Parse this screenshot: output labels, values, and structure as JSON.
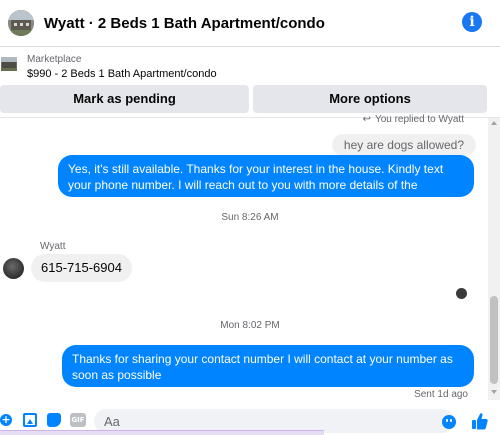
{
  "header": {
    "title": "Wyatt · 2 Beds 1 Bath Apartment/condo",
    "info_icon": "info-icon"
  },
  "listing": {
    "source": "Marketplace",
    "price_title": "$990 - 2 Beds 1 Bath Apartment/condo"
  },
  "actions": {
    "mark_pending": "Mark as pending",
    "more_options": "More options"
  },
  "messages": {
    "replied_label": "You replied to Wyatt",
    "quoted_text": "hey are dogs allowed?",
    "outgoing_1": "Yes, it's still available. Thanks for your interest in the house. Kindly text your phone number. I will reach out to you with more details of the property.",
    "timestamp_1": "Sun 8:26 AM",
    "sender_name": "Wyatt",
    "incoming_1": "615-715-6904",
    "timestamp_2": "Mon 8:02 PM",
    "outgoing_2": "Thanks for sharing your contact number I will contact at your number as soon as possible",
    "sent_status": "Sent 1d ago"
  },
  "composer": {
    "placeholder": "Aa",
    "gif_label": "GIF",
    "icons": [
      "plus-icon",
      "photo-icon",
      "sticker-icon",
      "gif-icon",
      "emoji-icon",
      "thumbs-up-icon"
    ]
  },
  "colors": {
    "accent": "#0084ff",
    "info": "#1877f2",
    "button_bg": "#e4e6eb",
    "incoming_bg": "#f0f0f0"
  }
}
